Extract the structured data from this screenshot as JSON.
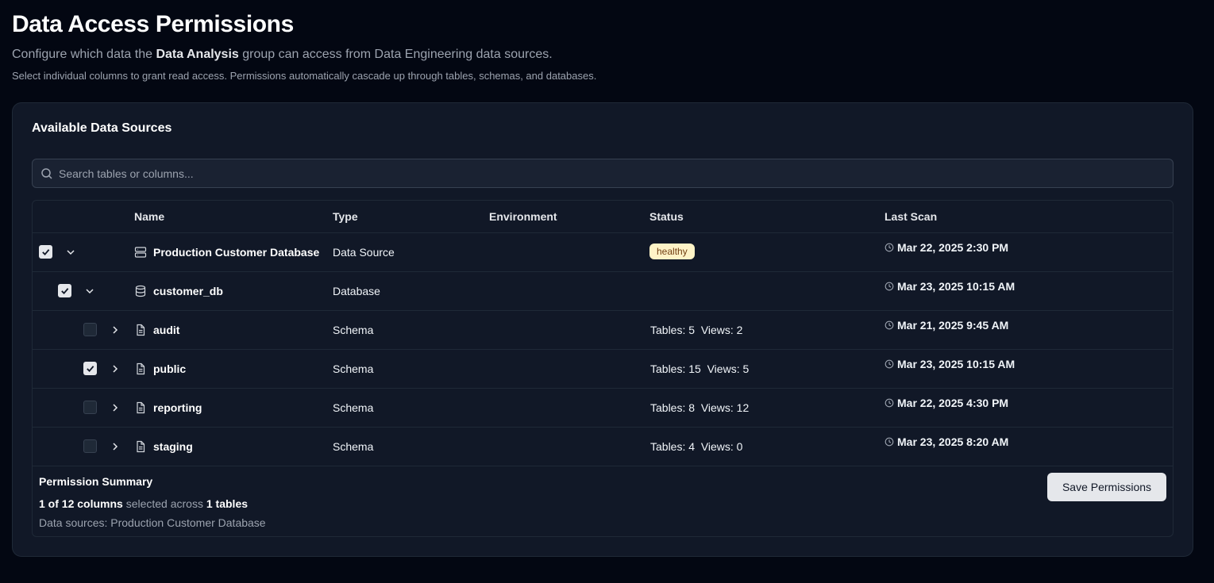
{
  "header": {
    "title": "Data Access Permissions",
    "subtitle_prefix": "Configure which data the",
    "subtitle_group": "Data Analysis",
    "subtitle_suffix": "group can access from Data Engineering data sources.",
    "hint": "Select individual columns to grant read access. Permissions automatically cascade up through tables, schemas, and databases."
  },
  "card": {
    "title": "Available Data Sources",
    "search_placeholder": "Search tables or columns..."
  },
  "table": {
    "columns": {
      "name": "Name",
      "type": "Type",
      "environment": "Environment",
      "status": "Status",
      "last_scan": "Last Scan"
    },
    "rows": [
      {
        "name": "Production Customer Database",
        "type": "Data Source",
        "status_badge": "healthy",
        "last_scan": "Mar 22, 2025 2:30 PM",
        "checked": true,
        "expanded": true,
        "icon": "server-icon"
      },
      {
        "name": "customer_db",
        "type": "Database",
        "last_scan": "Mar 23, 2025 10:15 AM",
        "checked": true,
        "expanded": true,
        "icon": "database-icon"
      },
      {
        "name": "audit",
        "type": "Schema",
        "status": "Tables: 5  Views: 2",
        "last_scan": "Mar 21, 2025 9:45 AM",
        "checked": false,
        "expanded": false,
        "icon": "file-icon"
      },
      {
        "name": "public",
        "type": "Schema",
        "status": "Tables: 15  Views: 5",
        "last_scan": "Mar 23, 2025 10:15 AM",
        "checked": true,
        "expanded": false,
        "icon": "file-icon"
      },
      {
        "name": "reporting",
        "type": "Schema",
        "status": "Tables: 8  Views: 12",
        "last_scan": "Mar 22, 2025 4:30 PM",
        "checked": false,
        "expanded": false,
        "icon": "file-icon"
      },
      {
        "name": "staging",
        "type": "Schema",
        "status": "Tables: 4  Views: 0",
        "last_scan": "Mar 23, 2025 8:20 AM",
        "checked": false,
        "expanded": false,
        "icon": "file-icon"
      }
    ]
  },
  "summary": {
    "title": "Permission Summary",
    "columns_count": "1 of 12 columns",
    "selected_across": "selected across",
    "tables_count": "1 tables",
    "sources": "Data sources: Production Customer Database",
    "save_label": "Save Permissions"
  },
  "colors": {
    "background": "#030712",
    "card": "#111827",
    "badge_bg": "#fef3c7",
    "badge_text": "#713f12",
    "button_bg": "#e5e7eb"
  }
}
